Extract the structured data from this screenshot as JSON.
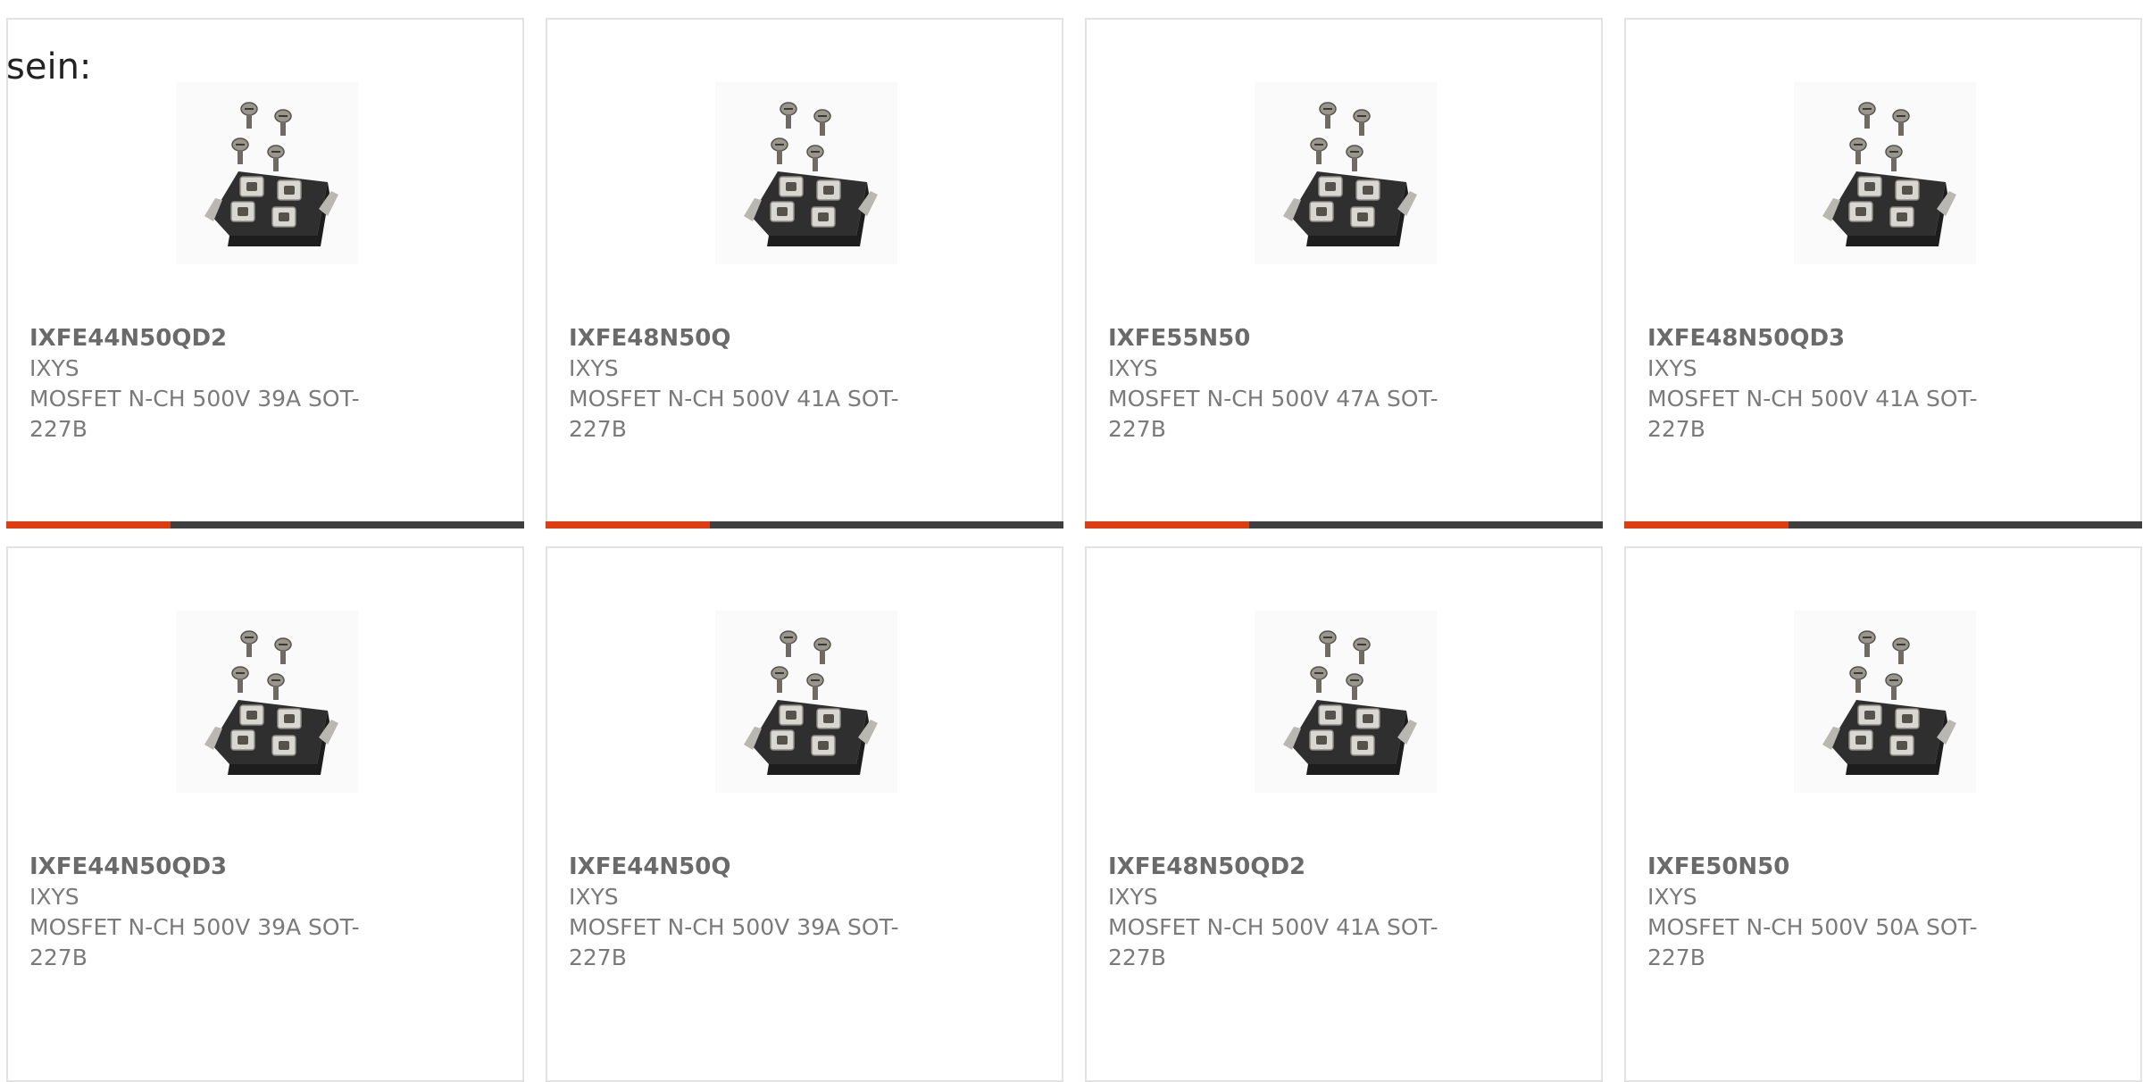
{
  "lead_text": "sein:",
  "colors": {
    "accent": "#e03c10",
    "bar_dark": "#3f3f3f",
    "border": "#e2e2e2",
    "title_text": "#6a6a6a",
    "body_text": "#7a7a7a"
  },
  "products": [
    {
      "part_number": "IXFE44N50QD2",
      "manufacturer": "IXYS",
      "description": "MOSFET N-CH 500V 39A SOT-227B",
      "image_icon": "sot227b-module-icon"
    },
    {
      "part_number": "IXFE48N50Q",
      "manufacturer": "IXYS",
      "description": "MOSFET N-CH 500V 41A SOT-227B",
      "image_icon": "sot227b-module-icon"
    },
    {
      "part_number": "IXFE55N50",
      "manufacturer": "IXYS",
      "description": "MOSFET N-CH 500V 47A SOT-227B",
      "image_icon": "sot227b-module-icon"
    },
    {
      "part_number": "IXFE48N50QD3",
      "manufacturer": "IXYS",
      "description": "MOSFET N-CH 500V 41A SOT-227B",
      "image_icon": "sot227b-module-icon"
    },
    {
      "part_number": "IXFE44N50QD3",
      "manufacturer": "IXYS",
      "description": "MOSFET N-CH 500V 39A SOT-227B",
      "image_icon": "sot227b-module-icon"
    },
    {
      "part_number": "IXFE44N50Q",
      "manufacturer": "IXYS",
      "description": "MOSFET N-CH 500V 39A SOT-227B",
      "image_icon": "sot227b-module-icon"
    },
    {
      "part_number": "IXFE48N50QD2",
      "manufacturer": "IXYS",
      "description": "MOSFET N-CH 500V 41A SOT-227B",
      "image_icon": "sot227b-module-icon"
    },
    {
      "part_number": "IXFE50N50",
      "manufacturer": "IXYS",
      "description": "MOSFET N-CH 500V 50A SOT-227B",
      "image_icon": "sot227b-module-icon"
    }
  ]
}
